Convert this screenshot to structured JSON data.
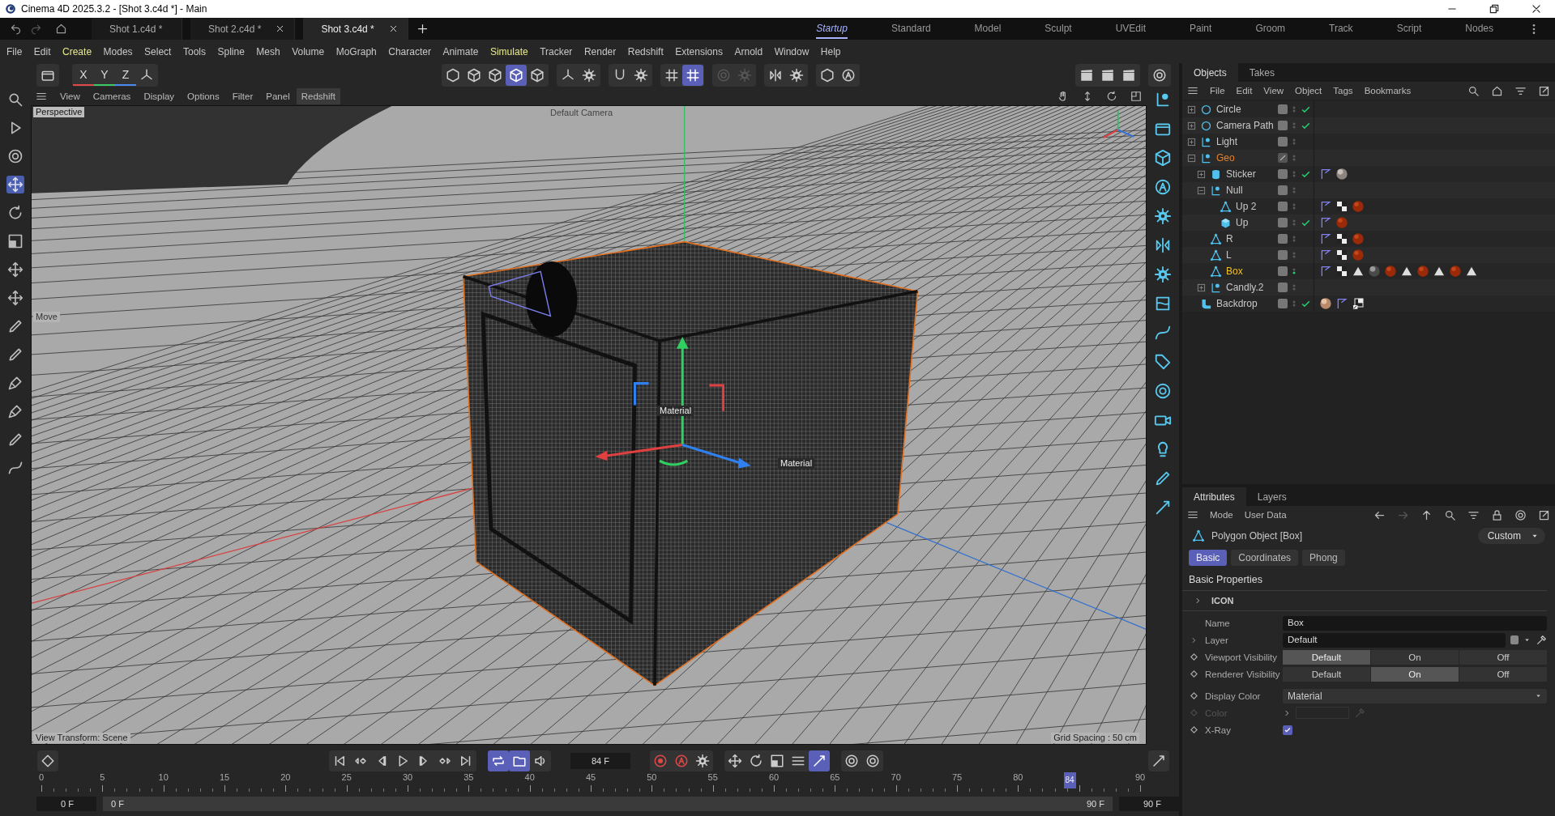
{
  "window": {
    "title": "Cinema 4D 2025.3.2 - [Shot 3.c4d *] - Main"
  },
  "document_tabs": [
    {
      "label": "Shot 1.c4d *",
      "selected": false,
      "closable": false
    },
    {
      "label": "Shot 2.c4d *",
      "selected": false,
      "closable": true
    },
    {
      "label": "Shot 3.c4d *",
      "selected": true,
      "closable": true
    }
  ],
  "layouts": [
    {
      "label": "Startup",
      "selected": true
    },
    {
      "label": "Standard",
      "selected": false
    },
    {
      "label": "Model",
      "selected": false
    },
    {
      "label": "Sculpt",
      "selected": false
    },
    {
      "label": "UVEdit",
      "selected": false
    },
    {
      "label": "Paint",
      "selected": false
    },
    {
      "label": "Groom",
      "selected": false
    },
    {
      "label": "Track",
      "selected": false
    },
    {
      "label": "Script",
      "selected": false
    },
    {
      "label": "Nodes",
      "selected": false
    }
  ],
  "menu": [
    {
      "label": "File",
      "color": "#c8c8c8"
    },
    {
      "label": "Edit",
      "color": "#c8c8c8"
    },
    {
      "label": "Create",
      "color": "#e8e890"
    },
    {
      "label": "Modes",
      "color": "#c8c8c8"
    },
    {
      "label": "Select",
      "color": "#c8c8c8"
    },
    {
      "label": "Tools",
      "color": "#c8c8c8"
    },
    {
      "label": "Spline",
      "color": "#c8c8c8"
    },
    {
      "label": "Mesh",
      "color": "#c8c8c8"
    },
    {
      "label": "Volume",
      "color": "#c8c8c8"
    },
    {
      "label": "MoGraph",
      "color": "#c8c8c8"
    },
    {
      "label": "Character",
      "color": "#c8c8c8"
    },
    {
      "label": "Animate",
      "color": "#c8c8c8"
    },
    {
      "label": "Simulate",
      "color": "#e8e890"
    },
    {
      "label": "Tracker",
      "color": "#c8c8c8"
    },
    {
      "label": "Render",
      "color": "#c8c8c8"
    },
    {
      "label": "Redshift",
      "color": "#c8c8c8"
    },
    {
      "label": "Extensions",
      "color": "#c8c8c8"
    },
    {
      "label": "Arnold",
      "color": "#c8c8c8"
    },
    {
      "label": "Window",
      "color": "#c8c8c8"
    },
    {
      "label": "Help",
      "color": "#c8c8c8"
    }
  ],
  "toolbar": {
    "axis_lock": [
      {
        "label": "X",
        "color": "#e04848"
      },
      {
        "label": "Y",
        "color": "#3cc864"
      },
      {
        "label": "Z",
        "color": "#4a8af0"
      }
    ],
    "modes": [
      {
        "selected": false
      },
      {
        "selected": false
      },
      {
        "selected": false
      },
      {
        "selected": true
      },
      {
        "selected": false
      }
    ],
    "snap_grid_on": true
  },
  "tools": [
    {
      "selected": false
    },
    {
      "selected": false
    },
    {
      "selected": true
    },
    {
      "selected": false
    },
    {
      "selected": false
    },
    {
      "selected": false
    },
    {
      "selected": false
    },
    {
      "selected": false
    },
    {
      "selected": false
    },
    {
      "selected": false
    },
    {
      "selected": false
    },
    {
      "selected": false
    },
    {
      "selected": false
    }
  ],
  "viewport": {
    "menu": [
      {
        "label": "View",
        "selected": false
      },
      {
        "label": "Cameras",
        "selected": false
      },
      {
        "label": "Display",
        "selected": false
      },
      {
        "label": "Options",
        "selected": false
      },
      {
        "label": "Filter",
        "selected": false
      },
      {
        "label": "Panel",
        "selected": false
      },
      {
        "label": "Redshift",
        "selected": true
      }
    ],
    "camera": "Perspective",
    "camera_name": "Default Camera",
    "hud_label": "Move",
    "material_labels": [
      "Material",
      "Material"
    ],
    "view_transform": "View Transform: Scene",
    "grid_spacing": "Grid Spacing : 50 cm"
  },
  "objects": {
    "tabs": [
      {
        "label": "Objects",
        "selected": true
      },
      {
        "label": "Takes",
        "selected": false
      }
    ],
    "menu": [
      "File",
      "Edit",
      "View",
      "Object",
      "Tags",
      "Bookmarks"
    ],
    "tree": [
      {
        "name": "Circle",
        "kind": "spline",
        "expanded": false,
        "selected": false,
        "layer_edit": false,
        "render_on": false,
        "enabled": true
      },
      {
        "name": "Camera Path",
        "kind": "spline",
        "expanded": false,
        "selected": false,
        "layer_edit": false,
        "render_on": false,
        "enabled": true
      },
      {
        "name": "Light",
        "kind": "group",
        "expanded": false,
        "selected": false,
        "layer_edit": false,
        "render_on": false,
        "enabled": false
      },
      {
        "name": "Geo",
        "kind": "group",
        "expanded": true,
        "selected": false,
        "layer_edit": true,
        "render_on": false,
        "enabled": false,
        "children": [
          {
            "name": "Sticker",
            "kind": "cylinder",
            "expanded": false,
            "selected": false,
            "layer_edit": false,
            "render_on": false,
            "enabled": true,
            "tags": [
              {
                "kind": "phong"
              },
              {
                "kind": "stone"
              }
            ]
          },
          {
            "name": "Null",
            "kind": "group",
            "expanded": true,
            "selected": false,
            "layer_edit": false,
            "render_on": false,
            "enabled": false,
            "children": [
              {
                "name": "Up 2",
                "kind": "mesh",
                "selected": false,
                "layer_edit": false,
                "render_on": false,
                "enabled": false,
                "tags": [
                  {
                    "kind": "phong"
                  },
                  {
                    "kind": "checker"
                  },
                  {
                    "kind": "red"
                  }
                ]
              },
              {
                "name": "Up",
                "kind": "cube",
                "selected": false,
                "layer_edit": false,
                "render_on": false,
                "enabled": true,
                "tags": [
                  {
                    "kind": "phong"
                  },
                  {
                    "kind": "red"
                  }
                ]
              }
            ]
          },
          {
            "name": "R",
            "kind": "mesh",
            "selected": false,
            "layer_edit": false,
            "render_on": false,
            "enabled": false,
            "tags": [
              {
                "kind": "phong"
              },
              {
                "kind": "checker"
              },
              {
                "kind": "red"
              }
            ]
          },
          {
            "name": "L",
            "kind": "mesh",
            "selected": false,
            "layer_edit": false,
            "render_on": false,
            "enabled": false,
            "tags": [
              {
                "kind": "phong"
              },
              {
                "kind": "checker"
              },
              {
                "kind": "red"
              }
            ]
          },
          {
            "name": "Box",
            "kind": "mesh",
            "selected": true,
            "layer_edit": false,
            "render_on": true,
            "enabled": false,
            "tags": [
              {
                "kind": "phong"
              },
              {
                "kind": "checker"
              },
              {
                "kind": "triangle"
              },
              {
                "kind": "metal"
              },
              {
                "kind": "red"
              },
              {
                "kind": "triangle"
              },
              {
                "kind": "red"
              },
              {
                "kind": "triangle"
              },
              {
                "kind": "red"
              },
              {
                "kind": "triangle"
              }
            ]
          },
          {
            "name": "Candly.2",
            "kind": "group",
            "expanded": false,
            "selected": false,
            "layer_edit": false,
            "render_on": false,
            "enabled": false
          }
        ]
      },
      {
        "name": "Backdrop",
        "kind": "backdrop",
        "selected": false,
        "layer_edit": false,
        "render_on": false,
        "enabled": true,
        "tags": [
          {
            "kind": "tan"
          },
          {
            "kind": "phong"
          },
          {
            "kind": "link"
          }
        ]
      }
    ]
  },
  "attributes": {
    "tabs": [
      {
        "label": "Attributes",
        "selected": true
      },
      {
        "label": "Layers",
        "selected": false
      }
    ],
    "menu": [
      "Mode",
      "User Data"
    ],
    "object_title": "Polygon Object [Box]",
    "mode": "Custom",
    "subtabs": [
      {
        "label": "Basic",
        "selected": true
      },
      {
        "label": "Coordinates",
        "selected": false
      },
      {
        "label": "Phong",
        "selected": false
      }
    ],
    "section": "Basic Properties",
    "group": "ICON",
    "fields": [
      {
        "kind": "text",
        "label": "Name",
        "value": "Box"
      },
      {
        "kind": "layer",
        "label": "Layer",
        "value": "Default"
      },
      {
        "kind": "segmented",
        "label": "Viewport Visibility",
        "options": [
          {
            "label": "Default",
            "selected": true
          },
          {
            "label": "On",
            "selected": false
          },
          {
            "label": "Off",
            "selected": false
          }
        ]
      },
      {
        "kind": "segmented",
        "label": "Renderer Visibility",
        "options": [
          {
            "label": "Default",
            "selected": false
          },
          {
            "label": "On",
            "selected": true
          },
          {
            "label": "Off",
            "selected": false
          }
        ]
      },
      {
        "kind": "dropdown",
        "label": "Display Color",
        "value": "Material"
      },
      {
        "kind": "color",
        "label": "Color",
        "disabled": true
      },
      {
        "kind": "checkbox",
        "label": "X-Ray",
        "checked": true
      }
    ]
  },
  "timeline": {
    "current_frame": "84 F",
    "loop_on": true,
    "preview_on": true,
    "snap_on": true,
    "ruler": [
      "0",
      "5",
      "10",
      "15",
      "20",
      "25",
      "30",
      "35",
      "40",
      "45",
      "50",
      "55",
      "60",
      "65",
      "70",
      "75",
      "80",
      "90"
    ],
    "playhead": {
      "label": "84",
      "level": 0.9333
    },
    "range": {
      "start": "0 F",
      "min": "0 F",
      "max": "90 F",
      "end": "90 F"
    }
  }
}
